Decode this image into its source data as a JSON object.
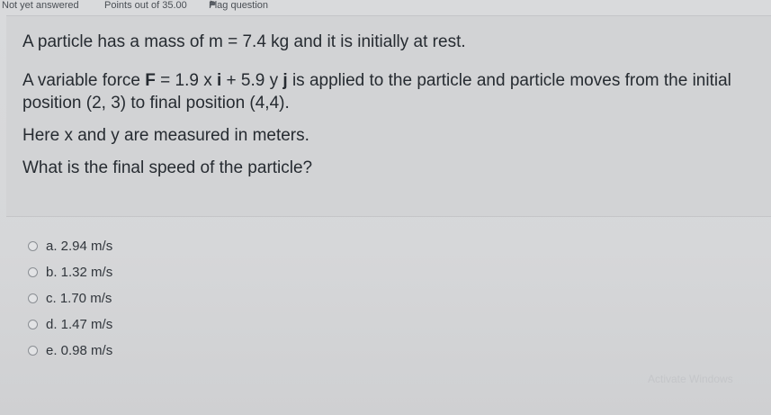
{
  "header": {
    "status": "Not yet answered",
    "points": "Points out of 35.00",
    "flag_label": "Flag question"
  },
  "question": {
    "line1": "A particle has a mass of m = 7.4 kg and it is initially at rest.",
    "line2_prefix": "A variable force ",
    "line2_F": "F",
    "line2_mid1": " = 1.9 x ",
    "line2_i": "i",
    "line2_mid2": " + 5.9 y ",
    "line2_j": "j",
    "line2_suffix": " is applied to the particle and particle moves from the initial position (2, 3) to final position (4,4).",
    "line3": "Here x and y are measured in meters.",
    "line4": "What is the final speed of the particle?"
  },
  "options": [
    {
      "label": "a. 2.94 m/s"
    },
    {
      "label": "b. 1.32 m/s"
    },
    {
      "label": "c. 1.70 m/s"
    },
    {
      "label": "d. 1.47 m/s"
    },
    {
      "label": "e. 0.98 m/s"
    }
  ],
  "watermark": "Activate Windows"
}
